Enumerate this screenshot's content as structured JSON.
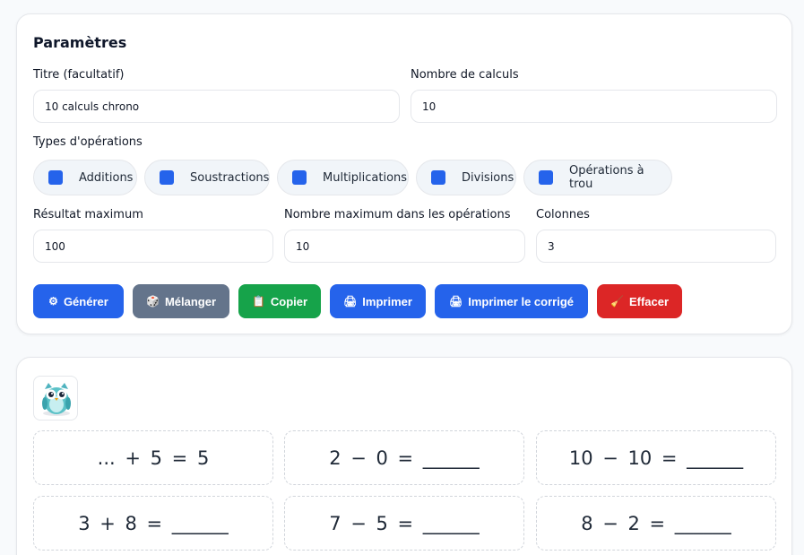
{
  "params": {
    "title": "Paramètres",
    "title_label": "Titre (facultatif)",
    "title_value": "10 calculs chrono",
    "count_label": "Nombre de calculs",
    "count_value": "10",
    "ops_label": "Types d'opérations",
    "operations": [
      {
        "label": "Additions",
        "checked": true
      },
      {
        "label": "Soustractions",
        "checked": true
      },
      {
        "label": "Multiplications",
        "checked": true
      },
      {
        "label": "Divisions",
        "checked": true
      },
      {
        "label": "Opérations à trou",
        "checked": true
      }
    ],
    "max_result_label": "Résultat maximum",
    "max_result_value": "100",
    "max_number_label": "Nombre maximum dans les opérations",
    "max_number_value": "10",
    "columns_label": "Colonnes",
    "columns_value": "3"
  },
  "actions": {
    "generate": {
      "icon": "⚙",
      "label": "Générer"
    },
    "shuffle": {
      "icon": "🎲",
      "label": "Mélanger"
    },
    "copy": {
      "icon": "📋",
      "label": "Copier"
    },
    "print": {
      "icon": "🖨",
      "label": "Imprimer"
    },
    "print_key": {
      "icon": "🖨",
      "label": "Imprimer le corrigé"
    },
    "clear": {
      "icon": "🧹",
      "label": "Effacer"
    }
  },
  "colors": {
    "primary": "#2563eb",
    "gray": "#64748b",
    "green": "#16a34a",
    "red": "#dc2626"
  },
  "sheet": {
    "logo_icon": "owl-icon",
    "calculations": [
      "... + 5 = 5",
      "2 − 0 = ______",
      "10 − 10 = ______",
      "3 + 8 = ______",
      "7 − 5 = ______",
      "8 − 2 = ______"
    ]
  }
}
